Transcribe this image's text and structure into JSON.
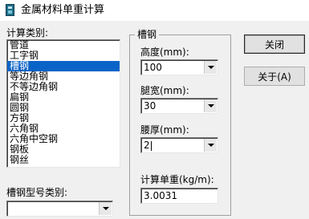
{
  "window": {
    "title": "金属材料单重计算",
    "icon": "app-icon"
  },
  "left": {
    "list_label": "计算类别:",
    "items": [
      "管道",
      "工字钢",
      "槽钢",
      "等边角钢",
      "不等边角钢",
      "扁钢",
      "圆钢",
      "方钢",
      "六角钢",
      "六角中空钢",
      "钢板",
      "钢丝"
    ],
    "selected_index": 2,
    "type_label": "槽钢型号类别:",
    "type_value": ""
  },
  "group": {
    "title": "槽钢",
    "height_label": "高度(mm):",
    "height_value": "100",
    "width_label": "腿宽(mm):",
    "width_value": "30",
    "thickness_label": "腰厚(mm):",
    "thickness_value": "2",
    "weight_label": "计算单重(kg/m):",
    "weight_value": "3.0031"
  },
  "buttons": {
    "close": "关闭",
    "about": "关于(A)"
  }
}
